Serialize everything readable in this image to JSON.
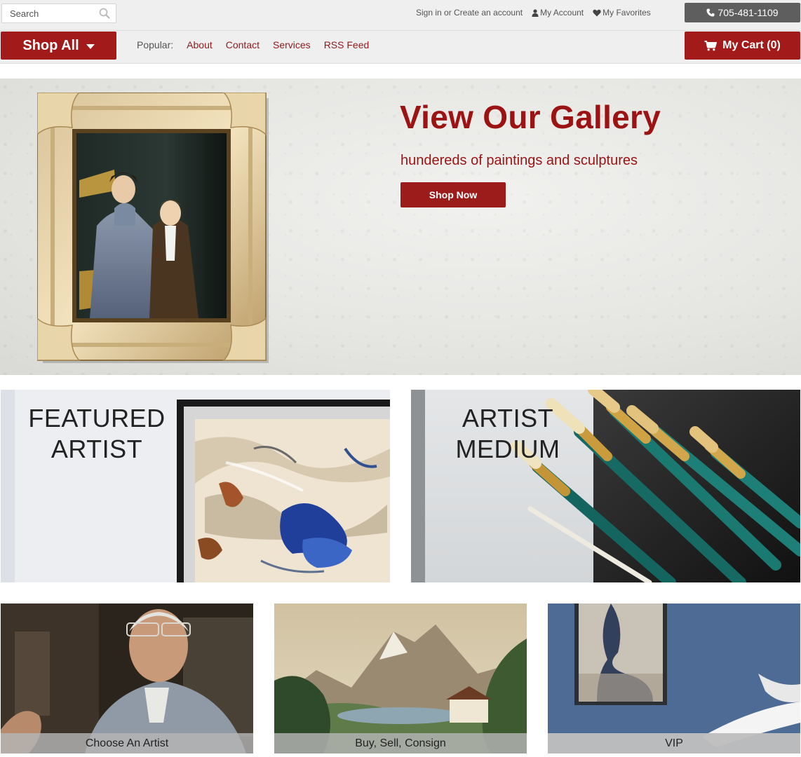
{
  "search": {
    "placeholder": "Search"
  },
  "utility": {
    "signin_label": "Sign in or Create an account",
    "account_label": "My Account",
    "favorites_label": "My Favorites",
    "phone": "705-481-1109"
  },
  "nav": {
    "shop_all_label": "Shop All",
    "popular_label": "Popular:",
    "links": [
      "About",
      "Contact",
      "Services",
      "RSS Feed"
    ],
    "cart_label": "My Cart (0)"
  },
  "hero": {
    "title": "View Our Gallery",
    "subtitle": "hundereds of paintings and sculptures",
    "button_label": "Shop Now"
  },
  "features": {
    "featured_artist": [
      "FEATURED",
      "ARTIST"
    ],
    "artist_medium": [
      "ARTIST",
      "MEDIUM"
    ]
  },
  "bottom_tiles": [
    {
      "label": "Choose An Artist"
    },
    {
      "label": "Buy, Sell, Consign"
    },
    {
      "label": "VIP"
    }
  ],
  "colors": {
    "brand_red": "#a21a1a",
    "link_red": "#8e1b1b",
    "phone_gray": "#5e5e5e"
  },
  "icons": [
    "search-icon",
    "user-icon",
    "heart-icon",
    "phone-icon",
    "caret-down-icon",
    "cart-icon"
  ]
}
